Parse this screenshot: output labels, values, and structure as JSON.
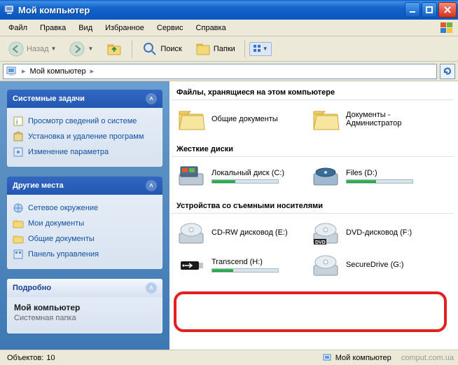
{
  "window": {
    "title": "Мой компьютер"
  },
  "menu": {
    "file": "Файл",
    "edit": "Правка",
    "view": "Вид",
    "favorites": "Избранное",
    "service": "Сервис",
    "help": "Справка"
  },
  "toolbar": {
    "back": "Назад",
    "search": "Поиск",
    "folders": "Папки"
  },
  "breadcrumb": {
    "root": "Мой компьютер"
  },
  "sidebar": {
    "tasks": {
      "title": "Системные задачи",
      "items": [
        {
          "label": "Просмотр сведений о системе"
        },
        {
          "label": "Установка и удаление программ"
        },
        {
          "label": "Изменение параметра"
        }
      ]
    },
    "places": {
      "title": "Другие места",
      "items": [
        {
          "label": "Сетевое окружение"
        },
        {
          "label": "Мои документы"
        },
        {
          "label": "Общие документы"
        },
        {
          "label": "Панель управления"
        }
      ]
    },
    "details": {
      "title": "Подробно",
      "name": "Мой компьютер",
      "type": "Системная папка"
    }
  },
  "sections": {
    "stored": "Файлы, хранящиеся на этом компьютере",
    "hdd": "Жесткие диски",
    "removable": "Устройства со съемными носителями"
  },
  "items": {
    "stored": [
      {
        "label": "Общие документы"
      },
      {
        "label": "Документы - Администратор"
      }
    ],
    "hdd": [
      {
        "label": "Локальный диск (C:)",
        "usage": 35
      },
      {
        "label": "Files (D:)",
        "usage": 45
      }
    ],
    "removable": [
      {
        "label": "CD-RW дисковод (E:)"
      },
      {
        "label": "DVD-дисковод (F:)"
      },
      {
        "label": "Transcend (H:)",
        "usage": 32
      },
      {
        "label": "SecureDrive (G:)"
      }
    ]
  },
  "status": {
    "objects_label": "Объектов:",
    "objects_count": "10",
    "location": "Мой компьютер",
    "watermark": "comput.com.ua"
  }
}
